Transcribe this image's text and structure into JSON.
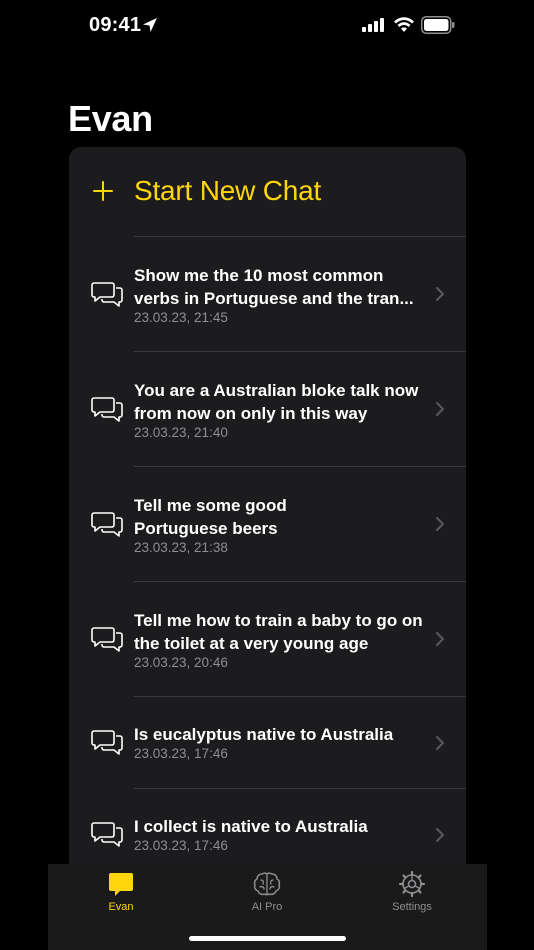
{
  "status_bar": {
    "time": "09:41"
  },
  "page_title": "Evan",
  "new_chat": {
    "label": "Start New Chat"
  },
  "chats": [
    {
      "title": "Show me the 10 most common verbs in Portuguese and the tran...",
      "date": "23.03.23, 21:45"
    },
    {
      "title": "You are a Australian bloke talk now from now on only in this way",
      "date": "23.03.23, 21:40"
    },
    {
      "title": "Tell me some good Portuguese beers",
      "date": "23.03.23, 21:38"
    },
    {
      "title": "Tell me how to train a baby to go on the toilet at a very young age",
      "date": "23.03.23, 20:46"
    },
    {
      "title": "Is eucalyptus native to Australia",
      "date": "23.03.23, 17:46"
    },
    {
      "title": "I collect is native to Australia",
      "date": "23.03.23, 17:46"
    }
  ],
  "tabs": [
    {
      "label": "Evan",
      "icon": "chat-bubble-icon",
      "active": true
    },
    {
      "label": "AI Pro",
      "icon": "brain-icon",
      "active": false
    },
    {
      "label": "Settings",
      "icon": "gear-icon",
      "active": false
    }
  ],
  "colors": {
    "accent": "#ffd60a",
    "card": "#1c1c1e",
    "secondary_text": "#8e8e93",
    "inactive_tab": "#8e8e93"
  }
}
